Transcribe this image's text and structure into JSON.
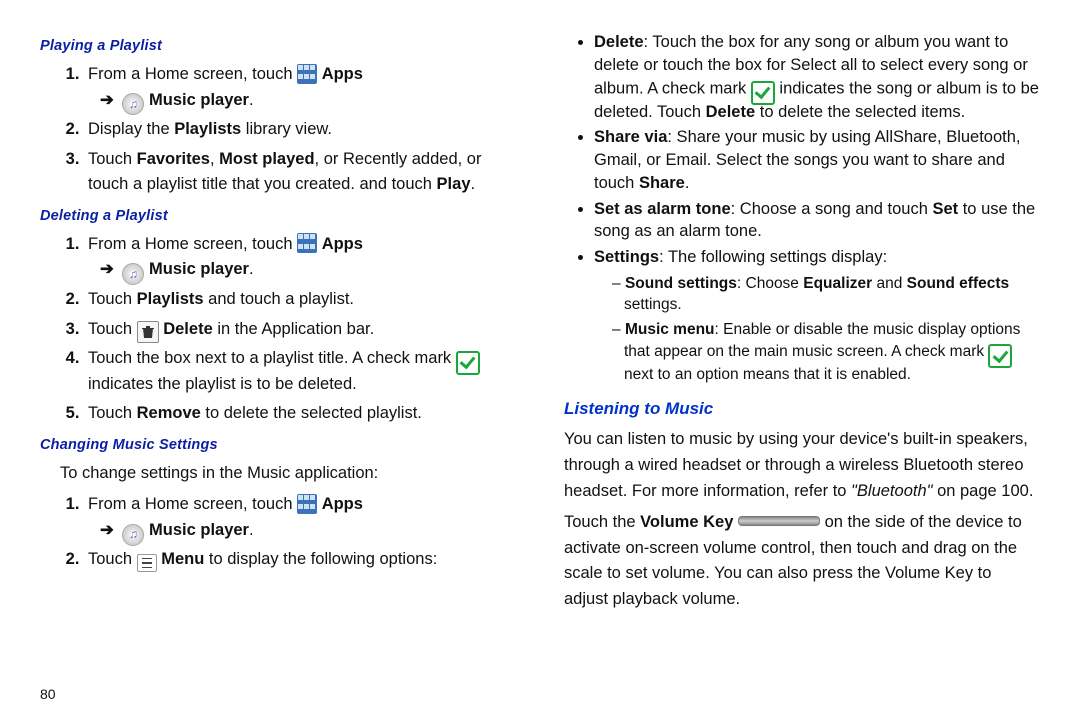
{
  "page_number": "80",
  "left": {
    "playing_heading": "Playing a Playlist",
    "playing_steps": {
      "s1a": "From a Home screen, touch",
      "s1_apps": "Apps",
      "s1_music": "Music player",
      "s2a": "Display the ",
      "s2b": "Playlists",
      "s2c": " library view.",
      "s3a": "Touch ",
      "s3b": "Favorites",
      "s3c": ", ",
      "s3d": "Most played",
      "s3e": ", or Recently added, or touch a playlist title that you created. and touch ",
      "s3f": "Play",
      "s3g": "."
    },
    "deleting_heading": "Deleting a Playlist",
    "deleting_steps": {
      "s1a": "From a Home screen, touch",
      "s1_apps": "Apps",
      "s1_music": "Music player",
      "s2a": "Touch ",
      "s2b": "Playlists",
      "s2c": " and touch a playlist.",
      "s3a": "Touch ",
      "s3b": "Delete",
      "s3c": " in the Application bar.",
      "s4a": "Touch the box next to a playlist title. A check mark ",
      "s4b": " indicates the playlist is to be deleted.",
      "s5a": "Touch ",
      "s5b": "Remove",
      "s5c": " to delete the selected playlist."
    },
    "changing_heading": "Changing Music Settings",
    "changing_intro": "To change settings in the Music application:",
    "changing_steps": {
      "s1a": "From a Home screen, touch",
      "s1_apps": "Apps",
      "s1_music": "Music player",
      "s2a": "Touch ",
      "s2b": "Menu",
      "s2c": " to display the following options:"
    }
  },
  "right": {
    "bullets": {
      "delete_a": "Delete",
      "delete_b": ": Touch the box for any song or album you want to delete or touch the box for Select all to select every song or album. A check mark ",
      "delete_c": " indicates the song or album is to be deleted. Touch ",
      "delete_d": "Delete",
      "delete_e": " to delete the selected items.",
      "share_a": "Share via",
      "share_b": ": Share your music by using AllShare, Bluetooth, Gmail, or Email. Select the songs you want to share and touch ",
      "share_c": "Share",
      "share_d": ".",
      "alarm_a": "Set as alarm tone",
      "alarm_b": ": Choose a song and touch ",
      "alarm_c": "Set",
      "alarm_d": " to use the song as an alarm tone.",
      "settings_a": "Settings",
      "settings_b": ": The following settings display:"
    },
    "dashes": {
      "sound_a": "Sound settings",
      "sound_b": ": Choose ",
      "sound_c": "Equalizer",
      "sound_d": " and ",
      "sound_e": "Sound effects",
      "sound_f": " settings.",
      "menu_a": "Music menu",
      "menu_b": ": Enable or disable the music display options that appear on the main music screen. A check mark ",
      "menu_c": " next to an option means that it is enabled."
    },
    "listening_heading": "Listening to Music",
    "listening_p1a": "You can listen to music by using your device's built-in speakers, through a wired headset or through a wireless Bluetooth stereo headset. For more information, refer to ",
    "listening_p1b": "\"Bluetooth\"",
    "listening_p1c": " on page 100.",
    "listening_p2a": "Touch the ",
    "listening_p2b": "Volume Key",
    "listening_p2c": " on the side of the device to activate on-screen volume control, then touch and drag on the scale to set volume. You can also press the Volume Key to adjust playback volume."
  }
}
